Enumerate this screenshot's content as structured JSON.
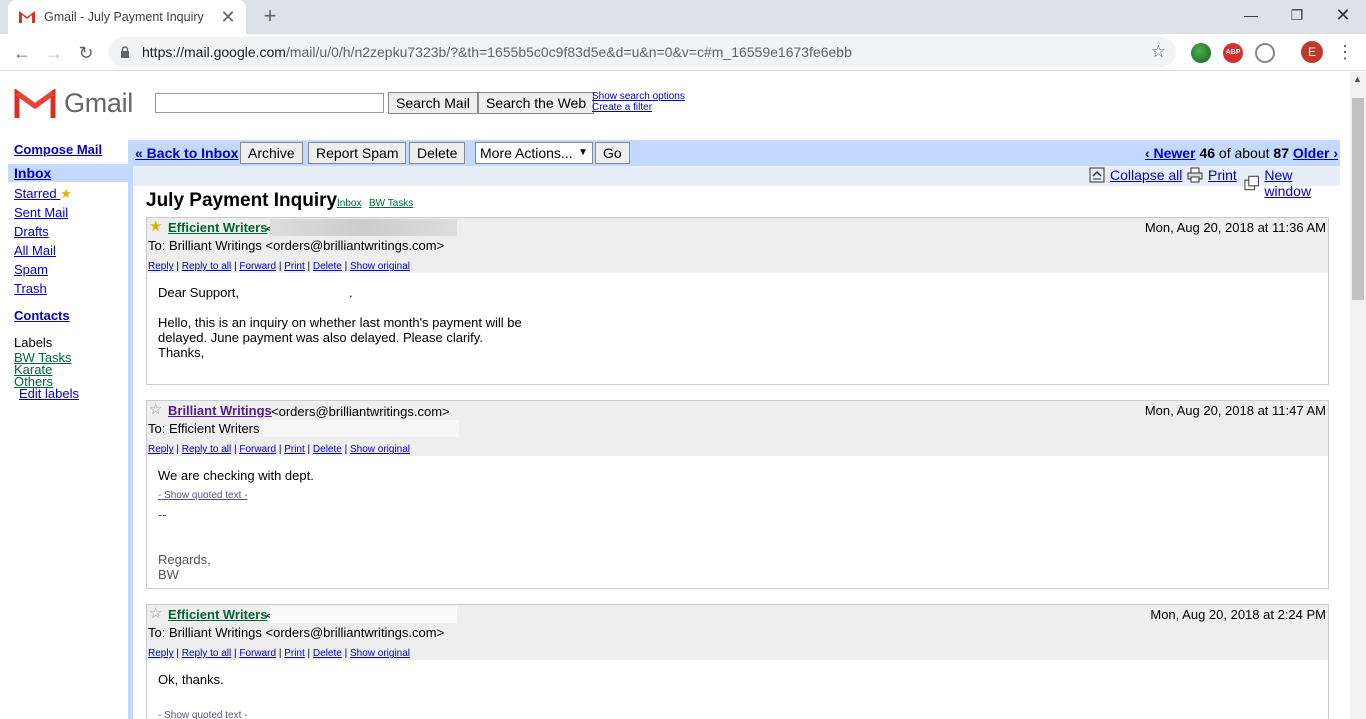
{
  "browser": {
    "tab_title": "Gmail - July Payment Inquiry",
    "url_host": "https://mail.google.com",
    "url_path": "/mail/u/0/h/n2zepku7323b/?&th=1655b5c0c9f83d5e&d=u&n=0&v=c#m_16559e1673fe6ebb",
    "profile_initial": "E",
    "ext_abp_label": "ABP"
  },
  "header": {
    "logo_text": "Gmail",
    "search_value": "",
    "search_mail_label": "Search Mail",
    "search_web_label": "Search the Web",
    "show_search_options": "Show search options",
    "create_filter": "Create a filter"
  },
  "sidebar": {
    "compose": "Compose Mail",
    "items": [
      {
        "label": "Inbox"
      },
      {
        "label": "Starred"
      },
      {
        "label": "Sent Mail"
      },
      {
        "label": "Drafts"
      },
      {
        "label": "All Mail"
      },
      {
        "label": "Spam"
      },
      {
        "label": "Trash"
      }
    ],
    "contacts": "Contacts",
    "labels_title": "Labels",
    "labels": [
      "BW Tasks",
      "Karate",
      "Others"
    ],
    "edit_labels": "Edit labels"
  },
  "actionbar": {
    "back": "« Back to Inbox",
    "archive": "Archive",
    "report_spam": "Report Spam",
    "delete": "Delete",
    "more_actions": "More Actions...",
    "go": "Go",
    "newer": "‹ Newer",
    "position": "46",
    "of_about": "of about",
    "total": "87",
    "older": "Older ›"
  },
  "subbar": {
    "collapse_all": "Collapse all",
    "print": "Print",
    "new_window": "New window"
  },
  "thread": {
    "subject": "July Payment Inquiry",
    "labels": [
      "Inbox",
      "BW Tasks"
    ],
    "actions": [
      "Reply",
      "Reply to all",
      "Forward",
      "Print",
      "Delete",
      "Show original"
    ],
    "messages": [
      {
        "sender": "Efficient Writers",
        "sender_addr": "<",
        "date": "Mon, Aug 20, 2018 at 11:36 AM",
        "to": "To: Brilliant Writings <orders@brilliantwritings.com>",
        "starred": true,
        "body": [
          "Dear Support,",
          ".",
          "Hello, this is an inquiry on whether last month's payment will be",
          "delayed. June payment was also delayed. Please clarify.",
          "Thanks,"
        ]
      },
      {
        "sender": "Brilliant Writings",
        "sender_addr": "<orders@brilliantwritings.com>",
        "date": "Mon, Aug 20, 2018 at 11:47 AM",
        "to": "To: Efficient Writers",
        "starred": false,
        "body": [
          "We are checking with dept."
        ],
        "quoted": "- Show quoted text -",
        "sig_sep": "--",
        "sig": [
          "Regards,",
          "BW"
        ]
      },
      {
        "sender": "Efficient Writers",
        "sender_addr": "<",
        "date": "Mon, Aug 20, 2018 at 2:24 PM",
        "to": "To: Brilliant Writings <orders@brilliantwritings.com>",
        "starred": false,
        "body": [
          "Ok, thanks."
        ],
        "quoted": "- Show quoted text -"
      }
    ]
  },
  "colors": {
    "nav_blue": "#c3d9ff",
    "link": "#0000cc",
    "sender_green": "#006633",
    "sender_purple": "#551a8b"
  }
}
